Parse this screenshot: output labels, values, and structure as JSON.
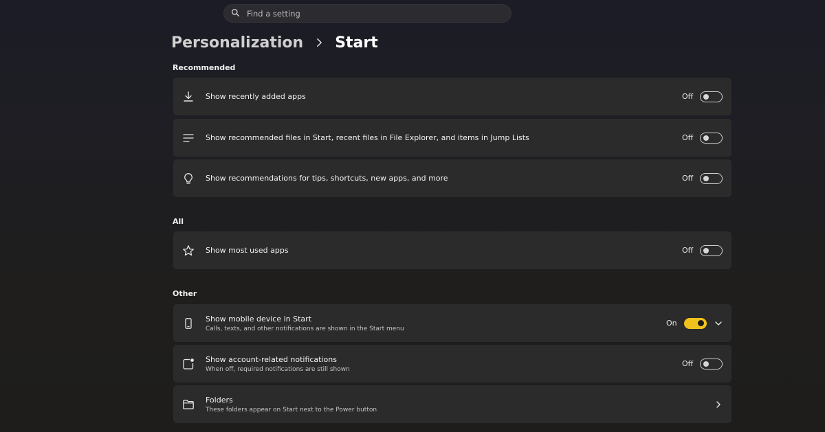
{
  "search": {
    "placeholder": "Find a setting",
    "icon": "search-icon"
  },
  "breadcrumb": {
    "parent": "Personalization",
    "current": "Start"
  },
  "sections": {
    "recommended": "Recommended",
    "all": "All",
    "other": "Other"
  },
  "settings": {
    "recently_added": {
      "label": "Show recently added apps",
      "state": "Off",
      "on": false,
      "icon": "download-icon"
    },
    "recommended_files": {
      "label": "Show recommended files in Start, recent files in File Explorer, and items in Jump Lists",
      "state": "Off",
      "on": false,
      "icon": "list-icon"
    },
    "recommendations_tips": {
      "label": "Show recommendations for tips, shortcuts, new apps, and more",
      "state": "Off",
      "on": false,
      "icon": "lightbulb-icon"
    },
    "most_used": {
      "label": "Show most used apps",
      "state": "Off",
      "on": false,
      "icon": "star-icon"
    },
    "mobile_device": {
      "label": "Show mobile device in Start",
      "desc": "Calls, texts, and other notifications are shown in the Start menu",
      "state": "On",
      "on": true,
      "icon": "phone-icon"
    },
    "account_notifications": {
      "label": "Show account-related notifications",
      "desc": "When off, required notifications are still shown",
      "state": "Off",
      "on": false,
      "icon": "notification-badge-icon"
    },
    "folders": {
      "label": "Folders",
      "desc": "These folders appear on Start next to the Power button",
      "icon": "folder-icon"
    }
  },
  "colors": {
    "accent": "#f1c21b",
    "card": "#2b2b2b"
  }
}
